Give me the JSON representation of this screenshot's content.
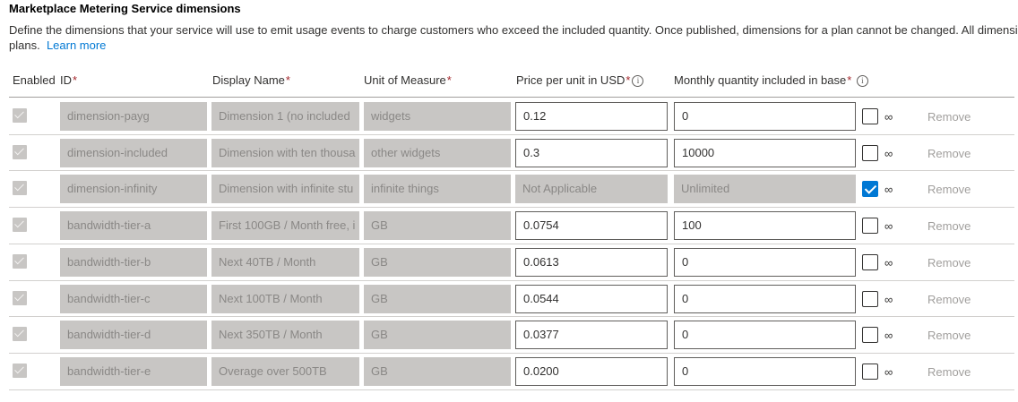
{
  "section": {
    "title": "Marketplace Metering Service dimensions",
    "description_line1": "Define the dimensions that your service will use to emit usage events to charge customers who exceed the included quantity. Once published, dimensions for a plan cannot be changed. All dimension deta",
    "description_line2": "plans.",
    "learn_more": "Learn more"
  },
  "table": {
    "headers": {
      "enabled": "Enabled",
      "id": "ID",
      "display_name": "Display Name",
      "unit": "Unit of Measure",
      "price": "Price per unit in USD",
      "quantity": "Monthly quantity included in base",
      "required_mark": "*",
      "info_glyph": "i"
    },
    "infinity_symbol": "∞",
    "remove_label": "Remove",
    "rows": [
      {
        "enabled": true,
        "id": "dimension-payg",
        "display_name": "Dimension 1 (no included",
        "unit": "widgets",
        "price": "0.12",
        "quantity": "0",
        "unlimited": false
      },
      {
        "enabled": true,
        "id": "dimension-included",
        "display_name": "Dimension with ten thousa",
        "unit": "other widgets",
        "price": "0.3",
        "quantity": "10000",
        "unlimited": false
      },
      {
        "enabled": true,
        "id": "dimension-infinity",
        "display_name": "Dimension with infinite stu",
        "unit": "infinite things",
        "price": "Not Applicable",
        "quantity": "Unlimited",
        "unlimited": true
      },
      {
        "enabled": true,
        "id": "bandwidth-tier-a",
        "display_name": "First 100GB / Month free, i",
        "unit": "GB",
        "price": "0.0754",
        "quantity": "100",
        "unlimited": false
      },
      {
        "enabled": true,
        "id": "bandwidth-tier-b",
        "display_name": "Next 40TB / Month",
        "unit": "GB",
        "price": "0.0613",
        "quantity": "0",
        "unlimited": false
      },
      {
        "enabled": true,
        "id": "bandwidth-tier-c",
        "display_name": "Next 100TB / Month",
        "unit": "GB",
        "price": "0.0544",
        "quantity": "0",
        "unlimited": false
      },
      {
        "enabled": true,
        "id": "bandwidth-tier-d",
        "display_name": "Next 350TB / Month",
        "unit": "GB",
        "price": "0.0377",
        "quantity": "0",
        "unlimited": false
      },
      {
        "enabled": true,
        "id": "bandwidth-tier-e",
        "display_name": "Overage over 500TB",
        "unit": "GB",
        "price": "0.0200",
        "quantity": "0",
        "unlimited": false
      }
    ]
  },
  "colors": {
    "accent": "#0078d4",
    "disabled_field": "#c8c6c4",
    "required": "#a4262c"
  }
}
